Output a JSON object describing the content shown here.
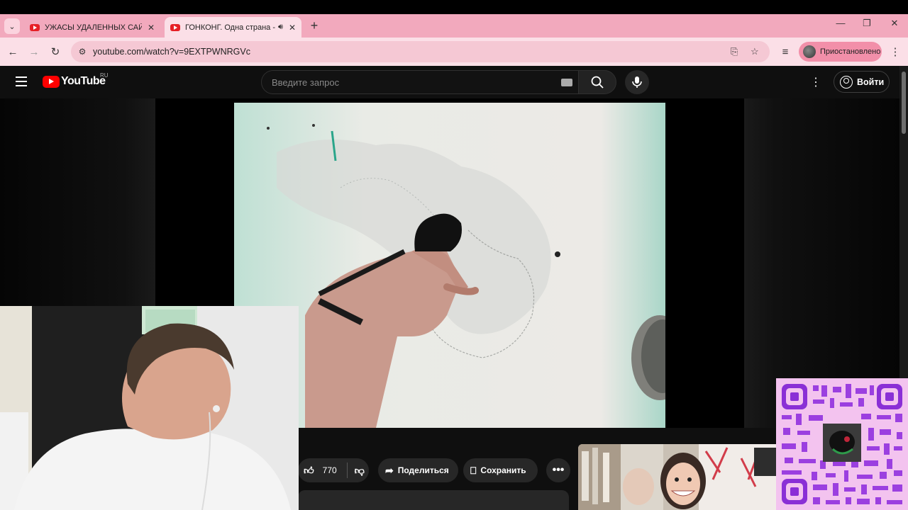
{
  "browser": {
    "tabs": [
      {
        "title": "УЖАСЫ УДАЛЕННЫХ САЙТОВ",
        "active": false
      },
      {
        "title": "ГОНКОНГ. Одна страна - д",
        "active": true
      }
    ],
    "url": "youtube.com/watch?v=9EXTPWNRGVc",
    "profile_label": "Приостановлено",
    "colors": {
      "tabbar": "#f2a9bd",
      "toolbar": "#fbdfe7"
    }
  },
  "youtube": {
    "logo_text": "YouTube",
    "region": "RU",
    "search_placeholder": "Введите запрос",
    "signin_label": "Войти",
    "actions": {
      "likes": "770",
      "share_label": "Поделиться",
      "save_label": "Сохранить"
    }
  }
}
